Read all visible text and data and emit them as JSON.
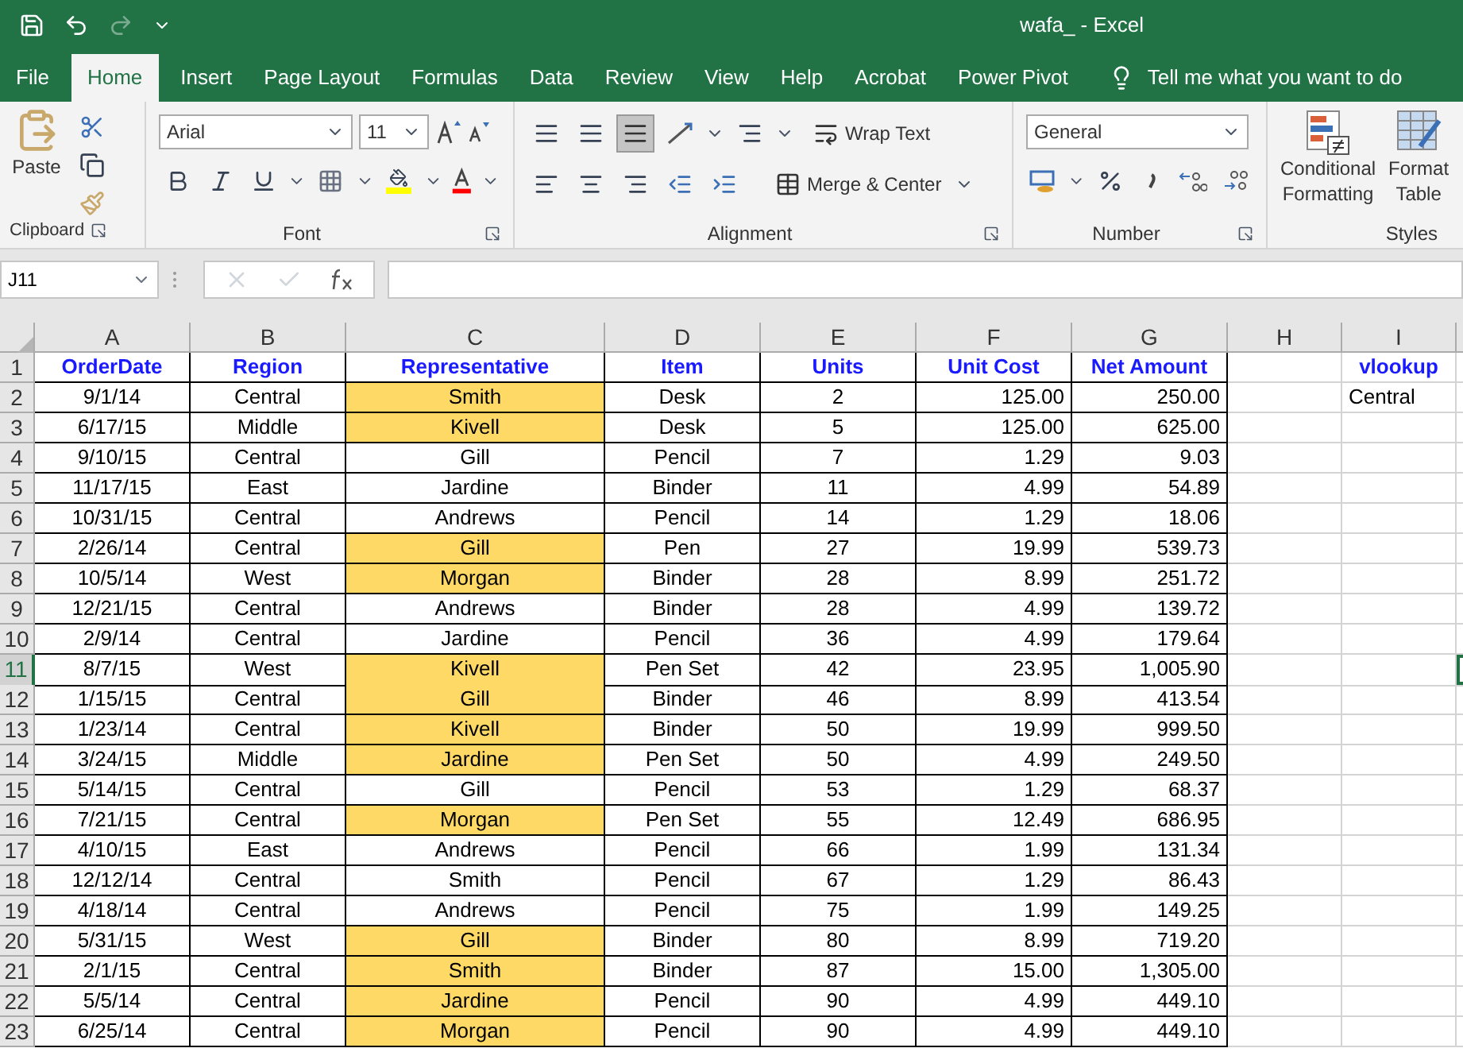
{
  "window": {
    "title": "wafa_  -  Excel"
  },
  "tabs": [
    {
      "label": "File",
      "selected": false
    },
    {
      "label": "Home",
      "selected": true
    },
    {
      "label": "Insert",
      "selected": false
    },
    {
      "label": "Page Layout",
      "selected": false
    },
    {
      "label": "Formulas",
      "selected": false
    },
    {
      "label": "Data",
      "selected": false
    },
    {
      "label": "Review",
      "selected": false
    },
    {
      "label": "View",
      "selected": false
    },
    {
      "label": "Help",
      "selected": false
    },
    {
      "label": "Acrobat",
      "selected": false
    },
    {
      "label": "Power Pivot",
      "selected": false
    }
  ],
  "tell_me": "Tell me what you want to do",
  "ribbon": {
    "clipboard": {
      "label": "Clipboard",
      "paste": "Paste"
    },
    "font": {
      "label": "Font",
      "font_name": "Arial",
      "font_size": "11"
    },
    "alignment": {
      "label": "Alignment",
      "wrap_text": "Wrap Text",
      "merge_center": "Merge & Center",
      "bottom_align_selected": true
    },
    "number": {
      "label": "Number",
      "format": "General"
    },
    "styles": {
      "label": "Styles",
      "conditional_formatting": [
        "Conditional",
        "Formatting"
      ],
      "format_table": [
        "Format",
        "Table"
      ]
    }
  },
  "name_box": "J11",
  "columns": [
    "A",
    "B",
    "C",
    "D",
    "E",
    "F",
    "G",
    "H",
    "I"
  ],
  "header_row": {
    "number": "1",
    "cells": [
      "OrderDate",
      "Region",
      "Representative",
      "Item",
      "Units",
      "Unit Cost",
      "Net Amount",
      "",
      "vlookup"
    ]
  },
  "rows": [
    {
      "number": "2",
      "selected": false,
      "highlighted": true,
      "cells": [
        "9/1/14",
        "Central",
        "Smith",
        "Desk",
        "2",
        "125.00",
        "250.00",
        "",
        "Central"
      ]
    },
    {
      "number": "3",
      "selected": false,
      "highlighted": true,
      "cells": [
        "6/17/15",
        "Middle",
        "Kivell",
        "Desk",
        "5",
        "125.00",
        "625.00",
        "",
        ""
      ]
    },
    {
      "number": "4",
      "selected": false,
      "highlighted": false,
      "cells": [
        "9/10/15",
        "Central",
        "Gill",
        "Pencil",
        "7",
        "1.29",
        "9.03",
        "",
        ""
      ]
    },
    {
      "number": "5",
      "selected": false,
      "highlighted": false,
      "cells": [
        "11/17/15",
        "East",
        "Jardine",
        "Binder",
        "11",
        "4.99",
        "54.89",
        "",
        ""
      ]
    },
    {
      "number": "6",
      "selected": false,
      "highlighted": false,
      "cells": [
        "10/31/15",
        "Central",
        "Andrews",
        "Pencil",
        "14",
        "1.29",
        "18.06",
        "",
        ""
      ]
    },
    {
      "number": "7",
      "selected": false,
      "highlighted": true,
      "cells": [
        "2/26/14",
        "Central",
        "Gill",
        "Pen",
        "27",
        "19.99",
        "539.73",
        "",
        ""
      ]
    },
    {
      "number": "8",
      "selected": false,
      "highlighted": true,
      "cells": [
        "10/5/14",
        "West",
        "Morgan",
        "Binder",
        "28",
        "8.99",
        "251.72",
        "",
        ""
      ]
    },
    {
      "number": "9",
      "selected": false,
      "highlighted": false,
      "cells": [
        "12/21/15",
        "Central",
        "Andrews",
        "Binder",
        "28",
        "4.99",
        "139.72",
        "",
        ""
      ]
    },
    {
      "number": "10",
      "selected": false,
      "highlighted": false,
      "cells": [
        "2/9/14",
        "Central",
        "Jardine",
        "Pencil",
        "36",
        "4.99",
        "179.64",
        "",
        ""
      ]
    },
    {
      "number": "11",
      "selected": true,
      "highlighted": true,
      "cells": [
        "8/7/15",
        "West",
        "Kivell",
        "Pen Set",
        "42",
        "23.95",
        "1,005.90",
        "",
        ""
      ]
    },
    {
      "number": "12",
      "selected": false,
      "highlighted": true,
      "cells": [
        "1/15/15",
        "Central",
        "Gill",
        "Binder",
        "46",
        "8.99",
        "413.54",
        "",
        ""
      ]
    },
    {
      "number": "13",
      "selected": false,
      "highlighted": true,
      "cells": [
        "1/23/14",
        "Central",
        "Kivell",
        "Binder",
        "50",
        "19.99",
        "999.50",
        "",
        ""
      ]
    },
    {
      "number": "14",
      "selected": false,
      "highlighted": true,
      "cells": [
        "3/24/15",
        "Middle",
        "Jardine",
        "Pen Set",
        "50",
        "4.99",
        "249.50",
        "",
        ""
      ]
    },
    {
      "number": "15",
      "selected": false,
      "highlighted": false,
      "cells": [
        "5/14/15",
        "Central",
        "Gill",
        "Pencil",
        "53",
        "1.29",
        "68.37",
        "",
        ""
      ]
    },
    {
      "number": "16",
      "selected": false,
      "highlighted": true,
      "cells": [
        "7/21/15",
        "Central",
        "Morgan",
        "Pen Set",
        "55",
        "12.49",
        "686.95",
        "",
        ""
      ]
    },
    {
      "number": "17",
      "selected": false,
      "highlighted": false,
      "cells": [
        "4/10/15",
        "East",
        "Andrews",
        "Pencil",
        "66",
        "1.99",
        "131.34",
        "",
        ""
      ]
    },
    {
      "number": "18",
      "selected": false,
      "highlighted": false,
      "cells": [
        "12/12/14",
        "Central",
        "Smith",
        "Pencil",
        "67",
        "1.29",
        "86.43",
        "",
        ""
      ]
    },
    {
      "number": "19",
      "selected": false,
      "highlighted": false,
      "cells": [
        "4/18/14",
        "Central",
        "Andrews",
        "Pencil",
        "75",
        "1.99",
        "149.25",
        "",
        ""
      ]
    },
    {
      "number": "20",
      "selected": false,
      "highlighted": true,
      "cells": [
        "5/31/15",
        "West",
        "Gill",
        "Binder",
        "80",
        "8.99",
        "719.20",
        "",
        ""
      ]
    },
    {
      "number": "21",
      "selected": false,
      "highlighted": true,
      "cells": [
        "2/1/15",
        "Central",
        "Smith",
        "Binder",
        "87",
        "15.00",
        "1,305.00",
        "",
        ""
      ]
    },
    {
      "number": "22",
      "selected": false,
      "highlighted": true,
      "cells": [
        "5/5/14",
        "Central",
        "Jardine",
        "Pencil",
        "90",
        "4.99",
        "449.10",
        "",
        ""
      ]
    },
    {
      "number": "23",
      "selected": false,
      "highlighted": true,
      "cells": [
        "6/25/14",
        "Central",
        "Morgan",
        "Pencil",
        "90",
        "4.99",
        "449.10",
        "",
        ""
      ]
    }
  ]
}
